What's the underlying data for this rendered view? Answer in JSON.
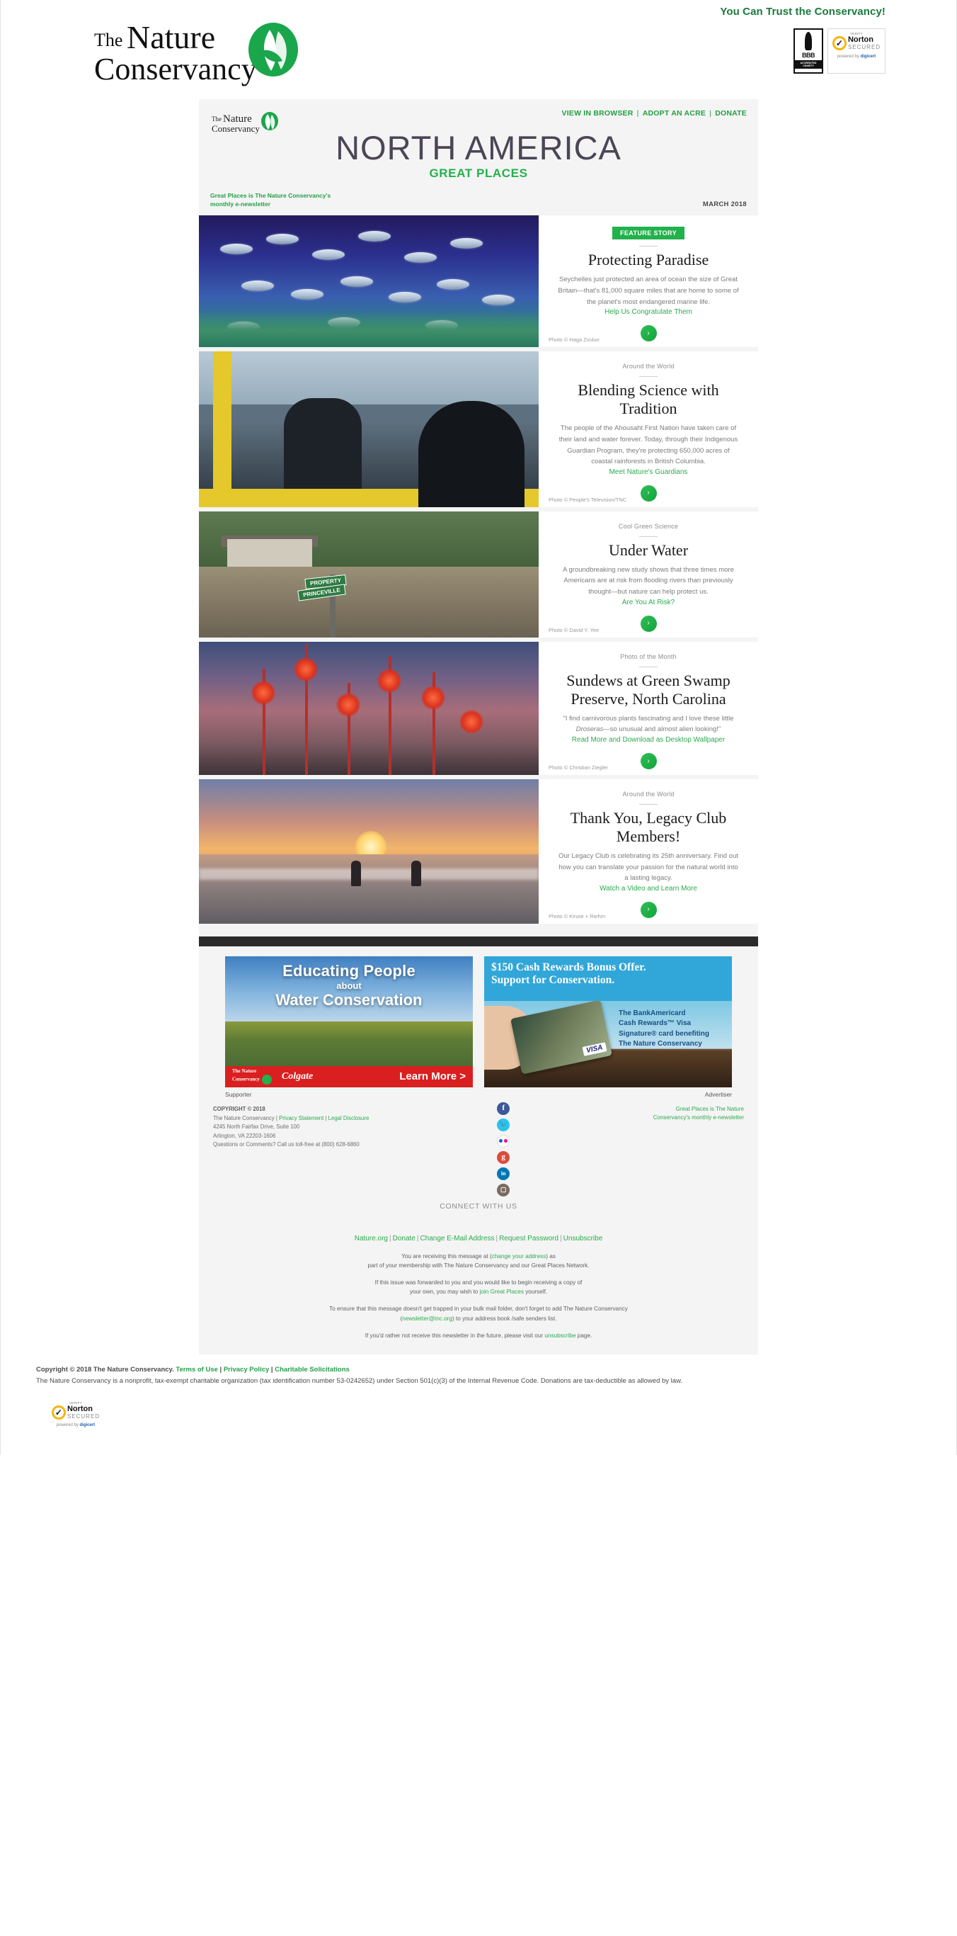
{
  "trust_header": {
    "tagline": "You Can Trust the Conservancy!",
    "logo_line1": "The",
    "logo_line2": "Nature",
    "logo_line3": "Conservancy",
    "bbb": {
      "name": "BBB",
      "sub": "ACCREDITED CHARITY"
    },
    "norton": {
      "verify": "VERIFY",
      "name": "Norton",
      "secured": "SECURED",
      "powered": "powered by ",
      "brand": "digicert"
    }
  },
  "newsletter": {
    "topnav": [
      {
        "label": "VIEW IN BROWSER"
      },
      {
        "label": "ADOPT AN ACRE"
      },
      {
        "label": "DONATE"
      }
    ],
    "title": "NORTH AMERICA",
    "subtitle": "GREAT PLACES",
    "tagline_line1": "Great Places is The Nature Conservancy's",
    "tagline_line2": "monthly e-newsletter",
    "issue_date": "MARCH 2018"
  },
  "stories": [
    {
      "kicker": "FEATURE STORY",
      "kicker_style": "badge",
      "title": "Protecting Paradise",
      "body": "Seychelles just protected an area of ocean the size of Great Britain—that's 81,000 square miles that are home to some of the planet's most endangered marine life.",
      "cta": "Help Us Congratulate Them",
      "arrow": "›",
      "credit": "Photo © Haga Zvulun",
      "art": "art-fish"
    },
    {
      "kicker": "Around the World",
      "kicker_style": "plain",
      "title": "Blending Science with Tradition",
      "body": "The people of the Ahousaht First Nation have taken care of their land and water forever. Today, through their Indigenous Guardian Program, they're protecting 650,000 acres of coastal rainforests in British Columbia.",
      "cta": "Meet Nature's Guardians",
      "arrow": "›",
      "credit": "Photo © People's Television/TNC",
      "art": "art-boat"
    },
    {
      "kicker": "Cool Green Science",
      "kicker_style": "plain",
      "title": "Under Water",
      "body": "A groundbreaking new study shows that three times more Americans are at risk from flooding rivers than previously thought—but nature can help protect us.",
      "cta": "Are You At Risk?",
      "arrow": "›",
      "credit": "Photo © David Y. Yee",
      "art": "art-flood"
    },
    {
      "kicker": "Photo of the Month",
      "kicker_style": "plain",
      "title": "Sundews at Green Swamp Preserve, North Carolina",
      "body_pre": "\"I find carnivorous plants fascinating and I love these little ",
      "body_italic": "Droseras",
      "body_post": "—so unusual and almost alien looking!\"",
      "cta": "Read More and Download as Desktop Wallpaper",
      "arrow": "›",
      "credit": "Photo © Christian Ziegler",
      "art": "art-sundew"
    },
    {
      "kicker": "Around the World",
      "kicker_style": "plain",
      "title": "Thank You, Legacy Club Members!",
      "body": "Our Legacy Club is celebrating its 25th anniversary. Find out how you can translate your passion for the natural world into a lasting legacy.",
      "cta": "Watch a Video and Learn More",
      "arrow": "›",
      "credit": "Photo © Kinzie + Riehm",
      "art": "art-beach"
    }
  ],
  "ads": [
    {
      "headline_1": "Educating People",
      "headline_2": "about",
      "headline_3": "Water Conservation",
      "brand_line1": "The Nature",
      "brand_line2": "Conservancy",
      "partner": "Colgate",
      "button": "Learn More >",
      "label": "Supporter"
    },
    {
      "headline_1": "$150 Cash Rewards Bonus Offer.",
      "headline_2": "Support for Conservation.",
      "copy_line1": "The BankAmericard",
      "copy_line2": "Cash Rewards™ Visa",
      "copy_line3": "Signature® card benefiting",
      "copy_line4": "The Nature Conservancy",
      "card_brand": "VISA",
      "label": "Advertiser"
    }
  ],
  "footer": {
    "copyright_header": "COPYRIGHT © 2018",
    "org": "The Nature Conservancy",
    "privacy": "Privacy Statement",
    "legal_disclosure": "Legal Disclosure",
    "address_1": "4245 North Fairfax Drive, Suite 100",
    "address_2": "Arlington, VA 22203-1606",
    "phone_line": "Questions or Comments? Call us toll-free at (800) 628-6860",
    "right_line1": "Great Places is The Nature",
    "right_line2": "Conservancy's monthly e-newsletter",
    "socials": [
      {
        "name": "facebook",
        "glyph": "f"
      },
      {
        "name": "twitter",
        "glyph": "ᵗ"
      },
      {
        "name": "flickr",
        "glyph": ""
      },
      {
        "name": "google-plus",
        "glyph": "g"
      },
      {
        "name": "linkedin",
        "glyph": "in"
      },
      {
        "name": "instagram",
        "glyph": "◯"
      }
    ],
    "connect_label": "CONNECT WITH US",
    "links": [
      {
        "label": "Nature.org"
      },
      {
        "label": "Donate"
      },
      {
        "label": "Change E-Mail Address"
      },
      {
        "label": "Request Password"
      },
      {
        "label": "Unsubscribe"
      }
    ],
    "legal_1_pre": "You are receiving this message at (",
    "legal_1_link": "change your address",
    "legal_1_post": ") as",
    "legal_1_line2": "part of your membership with The Nature Conservancy and our Great Places Network.",
    "legal_2_line1": "If this issue was forwarded to you and you would like to begin receiving a copy of",
    "legal_2_pre": "your own, you may wish to ",
    "legal_2_link": "join Great Places",
    "legal_2_post": " yourself.",
    "legal_3_line1": "To ensure that this message doesn't get trapped in your bulk mail folder, don't forget to add The Nature Conservancy",
    "legal_3_pre": "(",
    "legal_3_link": "newsletter@tnc.org",
    "legal_3_post": ") to your address book /safe senders list.",
    "legal_4_pre": "If you'd rather not receive this newsletter in the future, please visit our ",
    "legal_4_link": "unsubscribe",
    "legal_4_post": " page."
  },
  "bottom_legal": {
    "copy_pre": "Copyright © 2018 The Nature Conservancy. ",
    "terms": "Terms of Use",
    "privacy": "Privacy Policy",
    "charitable": "Charitable Solicitations",
    "body": "The Nature Conservancy is a nonprofit, tax-exempt charitable organization (tax identification number 53-0242652) under Section 501(c)(3) of the Internal Revenue Code. Donations are tax-deductible as allowed by law."
  }
}
